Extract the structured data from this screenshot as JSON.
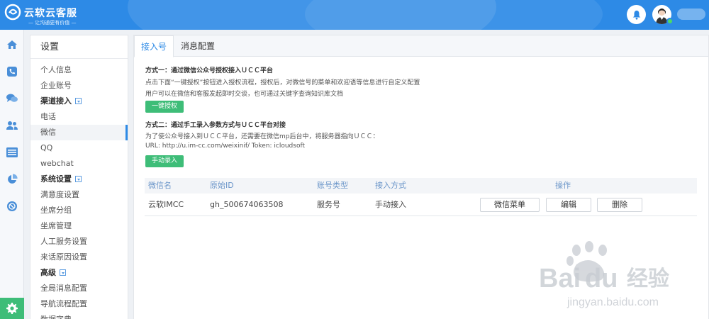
{
  "header": {
    "brand": "云软云客服",
    "slogan": "— 让沟通更有价值 —"
  },
  "rail": [
    "home-icon",
    "phone-icon",
    "chat-icon",
    "users-icon",
    "list-icon",
    "pie-chart-icon",
    "globe-icon",
    "gear-icon"
  ],
  "panel": {
    "title": "设置",
    "items": [
      {
        "label": "个人信息",
        "type": "item"
      },
      {
        "label": "企业账号",
        "type": "item"
      },
      {
        "label": "渠道接入",
        "type": "group"
      },
      {
        "label": "电话",
        "type": "item"
      },
      {
        "label": "微信",
        "type": "active"
      },
      {
        "label": "QQ",
        "type": "item"
      },
      {
        "label": "webchat",
        "type": "item"
      },
      {
        "label": "系统设置",
        "type": "group"
      },
      {
        "label": "满意度设置",
        "type": "item"
      },
      {
        "label": "坐席分组",
        "type": "item"
      },
      {
        "label": "坐席管理",
        "type": "item"
      },
      {
        "label": "人工服务设置",
        "type": "item"
      },
      {
        "label": "来话原因设置",
        "type": "item"
      },
      {
        "label": "高级",
        "type": "group"
      },
      {
        "label": "全局消息配置",
        "type": "item"
      },
      {
        "label": "导航流程配置",
        "type": "item"
      },
      {
        "label": "数据字典",
        "type": "item"
      }
    ]
  },
  "tabs": [
    "接入号",
    "消息配置"
  ],
  "content": {
    "method1_title": "方式一：通过微信公众号授权接入ＵＣＣ平台",
    "method1_line1": "点击下面“一键授权”按钮进入授权流程，授权后，对微信号的菜单和欢迎语等信息进行自定义配置",
    "method1_line2": "用户可以在微信和客服发起即时交谈，也可通过关键字查询知识库文档",
    "auth_button": "一键授权",
    "method2_title": "方式二：通过手工录入参数方式与ＵＣＣ平台对接",
    "method2_line1": "为了使公众号接入到ＵＣＣ平台，还需要在微信mp后台中，将服务器指向ＵＣＣ：",
    "url_line": "URL: http://u.im-cc.com/weixinif/      Token: icloudsoft",
    "manual_button": "手动录入"
  },
  "table": {
    "headers": [
      "微信名",
      "原始ID",
      "账号类型",
      "接入方式",
      "操作"
    ],
    "rows": [
      {
        "name": "云软IMCC",
        "id": "gh_500674063508",
        "type": "服务号",
        "mode": "手动接入"
      }
    ],
    "actions": [
      "微信菜单",
      "编辑",
      "删除"
    ]
  },
  "watermark": {
    "brand": "Bai",
    "brand2": "du",
    "cn": "经验",
    "url": "jingyan.baidu.com"
  },
  "colors": {
    "header": "#2d8ae6",
    "green": "#3ebd78",
    "table_header_text": "#6a95c9"
  }
}
